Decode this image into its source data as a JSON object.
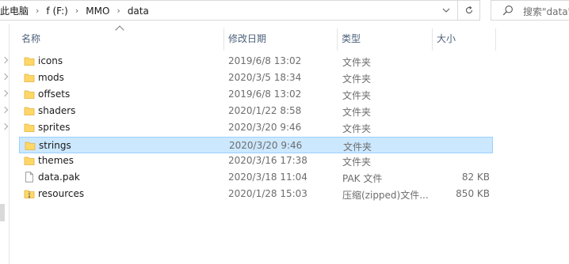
{
  "address": {
    "crumbs": [
      "此电脑",
      "f (F:)",
      "MMO",
      "data"
    ],
    "separator": "›"
  },
  "search": {
    "placeholder": "搜索\"data\""
  },
  "columns": {
    "name": "名称",
    "date": "修改日期",
    "type": "类型",
    "size": "大小"
  },
  "files": [
    {
      "icon": "folder-icon",
      "name": "icons",
      "date": "2019/6/8 13:02",
      "type": "文件夹",
      "size": ""
    },
    {
      "icon": "folder-icon",
      "name": "mods",
      "date": "2020/3/5 18:34",
      "type": "文件夹",
      "size": ""
    },
    {
      "icon": "folder-icon",
      "name": "offsets",
      "date": "2019/6/8 13:02",
      "type": "文件夹",
      "size": ""
    },
    {
      "icon": "folder-icon",
      "name": "shaders",
      "date": "2020/1/22 8:58",
      "type": "文件夹",
      "size": ""
    },
    {
      "icon": "folder-icon",
      "name": "sprites",
      "date": "2020/3/20 9:46",
      "type": "文件夹",
      "size": ""
    },
    {
      "icon": "folder-icon",
      "name": "strings",
      "date": "2020/3/20 9:46",
      "type": "文件夹",
      "size": "",
      "selected": true
    },
    {
      "icon": "folder-icon",
      "name": "themes",
      "date": "2020/3/16 17:38",
      "type": "文件夹",
      "size": ""
    },
    {
      "icon": "file-icon",
      "name": "data.pak",
      "date": "2020/3/18 11:04",
      "type": "PAK 文件",
      "size": "82 KB"
    },
    {
      "icon": "zip-folder-icon",
      "name": "resources",
      "date": "2020/1/28 15:03",
      "type": "压缩(zipped)文件...",
      "size": "850 KB"
    }
  ],
  "colors": {
    "selection_bg": "#cce8ff",
    "selection_border": "#99d1ff",
    "folder_yellow": "#ffd767",
    "header_text": "#4c607a"
  }
}
